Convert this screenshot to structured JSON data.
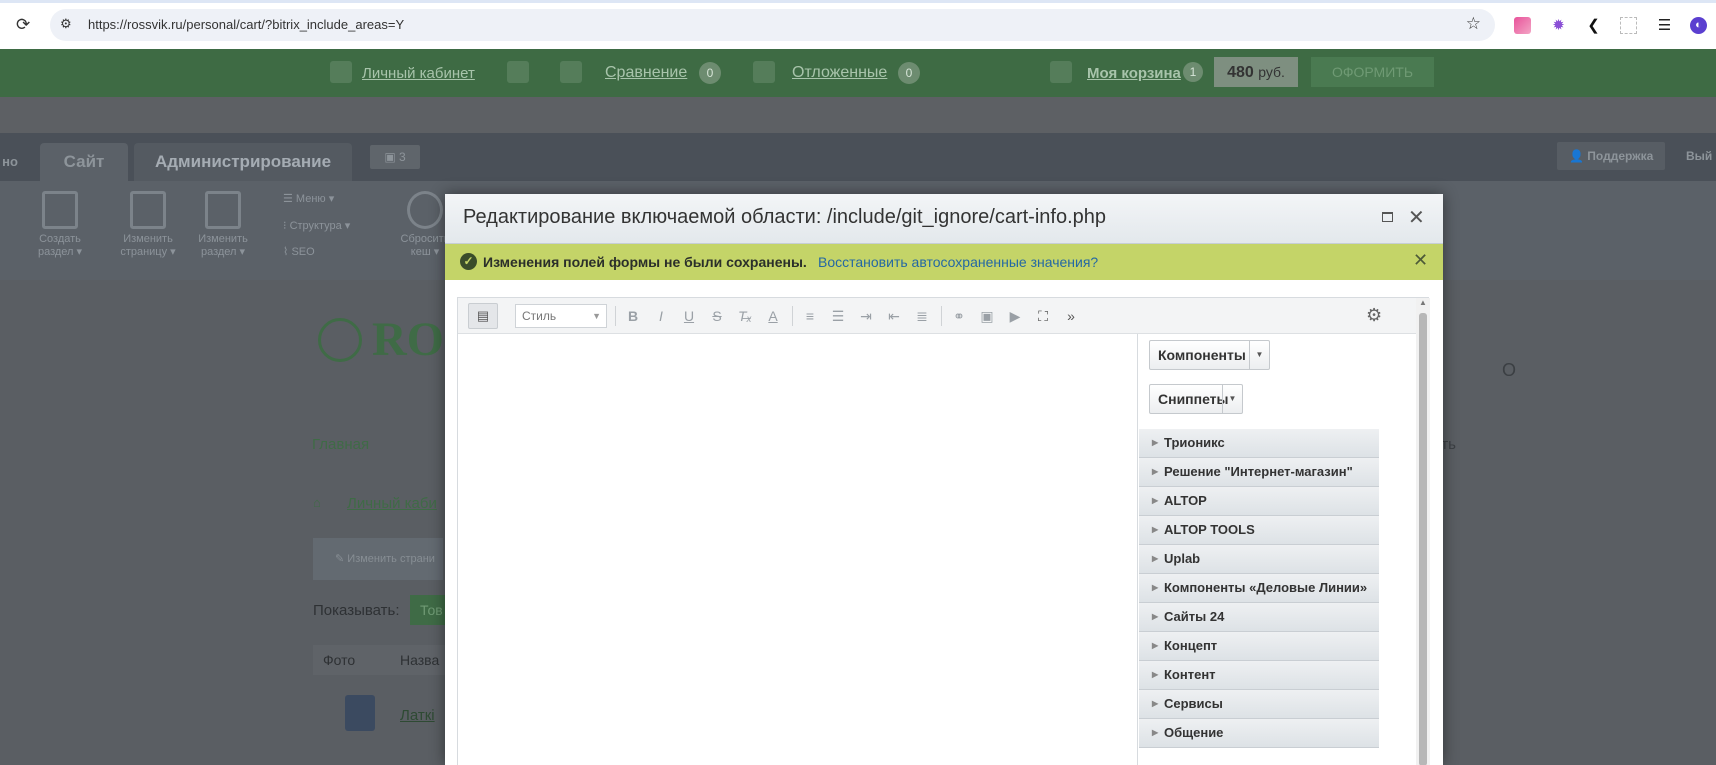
{
  "browser": {
    "url": "https://rossvik.ru/personal/cart/?bitrix_include_areas=Y"
  },
  "site_header": {
    "account_link": "Личный кабинет",
    "compare_link": "Сравнение",
    "compare_count": "0",
    "deferred_link": "Отложенные",
    "deferred_count": "0",
    "cart_link": "Моя корзина",
    "cart_count": "1",
    "price": "480",
    "price_unit": "руб.",
    "checkout_label": "ОФОРМИТЬ"
  },
  "admin_panel": {
    "tab_prefix": "но",
    "tab_site": "Сайт",
    "tab_admin": "Администрирование",
    "messages_count": "3",
    "support_label": "Поддержка",
    "exit_label": "Вый",
    "tools": [
      {
        "label": "Создать раздел ▾"
      },
      {
        "label": "Изменить страницу ▾"
      },
      {
        "label": "Изменить раздел ▾"
      }
    ],
    "menu_label": "Меню ▾",
    "structure_label": "Структура ▾",
    "seo_label": "SEO",
    "cache_label": "Сбросить кеш ▾"
  },
  "page": {
    "logo_text": "RO",
    "home_link": "Главная",
    "crumb_link": "Личный каби",
    "edit_page_btn": "Изменить страни",
    "show_label": "Показывать:",
    "goods_btn": "Тов",
    "col_photo": "Фото",
    "col_name": "Назва",
    "product_link": "Латкі",
    "right_frag_a": "О",
    "right_frag_b": "ть"
  },
  "dialog": {
    "title": "Редактирование включаемой области: /include/git_ignore/cart-info.php",
    "notice_text": "Изменения полей формы не были сохранены.",
    "notice_link": "Восстановить автосохраненные значения?",
    "style_select": "Стиль",
    "components_btn": "Компоненты",
    "snippets_btn": "Сниппеты",
    "categories": [
      "Трионикс",
      "Решение \"Интернет-магазин\"",
      "ALTOP",
      "ALTOP TOOLS",
      "Uplab",
      "Компоненты «Деловые Линии»",
      "Сайты 24",
      "Концепт",
      "Контент",
      "Сервисы",
      "Общение"
    ]
  },
  "colors": {
    "site_green": "#3e6b44",
    "notice_bg": "#c4d468",
    "link_blue": "#2468a3"
  }
}
